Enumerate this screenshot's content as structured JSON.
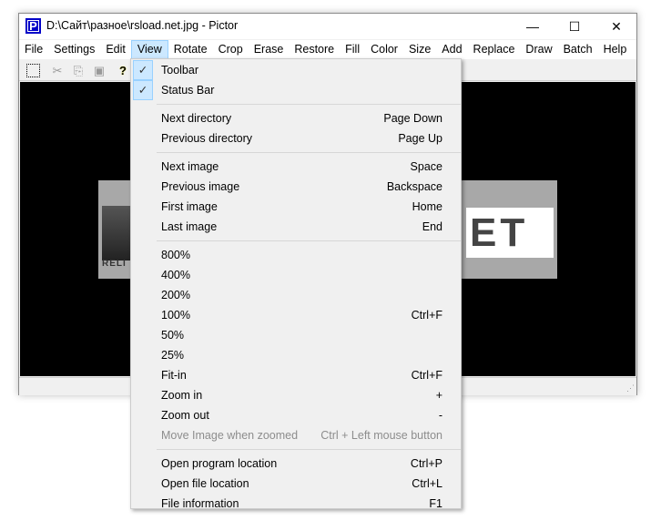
{
  "window": {
    "title": "D:\\Сайт\\разное\\rsload.net.jpg - Pictor",
    "icon_letter": "P",
    "min": "—",
    "max": "☐",
    "close": "✕"
  },
  "menubar": [
    "File",
    "Settings",
    "Edit",
    "View",
    "Rotate",
    "Crop",
    "Erase",
    "Restore",
    "Fill",
    "Color",
    "Size",
    "Add",
    "Replace",
    "Draw",
    "Batch",
    "Help"
  ],
  "logo": {
    "left_text": "RELI",
    "right_text": "ET"
  },
  "view_menu": {
    "groups": [
      [
        {
          "label": "Toolbar",
          "checked": true
        },
        {
          "label": "Status Bar",
          "checked": true
        }
      ],
      [
        {
          "label": "Next directory",
          "shortcut": "Page Down"
        },
        {
          "label": "Previous directory",
          "shortcut": "Page Up"
        }
      ],
      [
        {
          "label": "Next image",
          "shortcut": "Space"
        },
        {
          "label": "Previous image",
          "shortcut": "Backspace"
        },
        {
          "label": "First image",
          "shortcut": "Home"
        },
        {
          "label": "Last image",
          "shortcut": "End"
        }
      ],
      [
        {
          "label": "800%"
        },
        {
          "label": "400%"
        },
        {
          "label": "200%"
        },
        {
          "label": "100%",
          "shortcut": "Ctrl+F"
        },
        {
          "label": "50%"
        },
        {
          "label": "25%"
        },
        {
          "label": "Fit-in",
          "shortcut": "Ctrl+F"
        },
        {
          "label": "Zoom in",
          "shortcut": "+"
        },
        {
          "label": "Zoom out",
          "shortcut": "-"
        },
        {
          "label": "Move Image when zoomed",
          "shortcut": "Ctrl + Left mouse button",
          "disabled": true
        }
      ],
      [
        {
          "label": "Open program location",
          "shortcut": "Ctrl+P"
        },
        {
          "label": "Open file location",
          "shortcut": "Ctrl+L"
        },
        {
          "label": "File information",
          "shortcut": "F1"
        }
      ]
    ]
  }
}
